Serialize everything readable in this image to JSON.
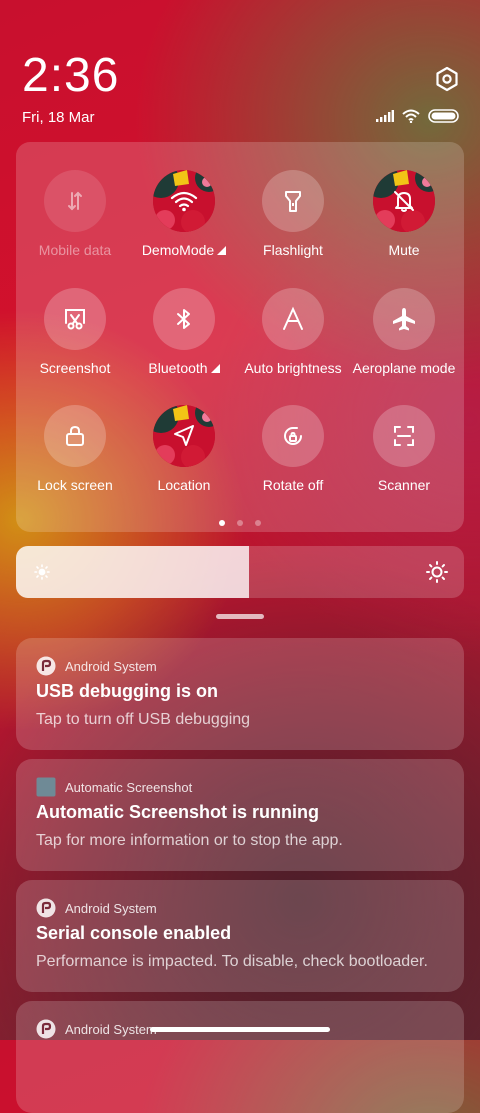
{
  "header": {
    "time": "2:36",
    "date": "Fri, 18 Mar"
  },
  "quick_settings": {
    "tiles": [
      {
        "label": "Mobile data",
        "icon": "mobile-data-icon",
        "state": "disabled"
      },
      {
        "label": "DemoMode",
        "icon": "wifi-icon",
        "state": "on",
        "has_menu": true
      },
      {
        "label": "Flashlight",
        "icon": "flashlight-icon",
        "state": "off"
      },
      {
        "label": "Mute",
        "icon": "bell-off-icon",
        "state": "on"
      },
      {
        "label": "Screenshot",
        "icon": "screenshot-icon",
        "state": "off"
      },
      {
        "label": "Bluetooth",
        "icon": "bluetooth-icon",
        "state": "off",
        "has_menu": true
      },
      {
        "label": "Auto brightness",
        "icon": "auto-brightness-icon",
        "state": "off"
      },
      {
        "label": "Aeroplane mode",
        "icon": "airplane-icon",
        "state": "off"
      },
      {
        "label": "Lock screen",
        "icon": "lock-icon",
        "state": "off"
      },
      {
        "label": "Location",
        "icon": "location-icon",
        "state": "on"
      },
      {
        "label": "Rotate off",
        "icon": "rotate-lock-icon",
        "state": "off"
      },
      {
        "label": "Scanner",
        "icon": "scanner-icon",
        "state": "off"
      }
    ],
    "page_count": 3,
    "active_page": 1
  },
  "brightness": {
    "level_percent": 52
  },
  "notifications": [
    {
      "app": "Android System",
      "title": "USB debugging is on",
      "body": "Tap to turn off USB debugging"
    },
    {
      "app": "Automatic Screenshot",
      "title": "Automatic Screenshot is running",
      "body": "Tap for more information or to stop the app."
    },
    {
      "app": "Android System",
      "title": "Serial console enabled",
      "body": "Performance is impacted. To disable, check bootloader."
    },
    {
      "app": "Android System",
      "title": "",
      "body": ""
    }
  ],
  "colors": {
    "accent_on": "#b81530",
    "panel": "rgba(255,255,255,0.18)"
  }
}
